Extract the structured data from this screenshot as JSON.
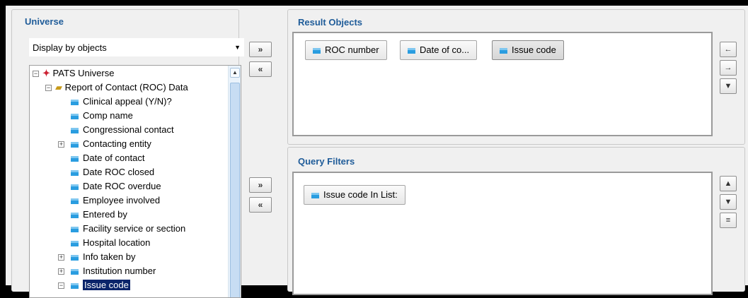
{
  "universe": {
    "title": "Universe",
    "display_select": "Display by objects",
    "tree": {
      "root": "PATS Universe",
      "folder": "Report of Contact (ROC) Data",
      "items": [
        {
          "label": "Clinical appeal (Y/N)?",
          "expandable": false,
          "selected": false
        },
        {
          "label": "Comp name",
          "expandable": false,
          "selected": false
        },
        {
          "label": "Congressional contact",
          "expandable": false,
          "selected": false
        },
        {
          "label": "Contacting entity",
          "expandable": true,
          "selected": false
        },
        {
          "label": "Date of contact",
          "expandable": false,
          "selected": false
        },
        {
          "label": "Date ROC closed",
          "expandable": false,
          "selected": false
        },
        {
          "label": "Date ROC overdue",
          "expandable": false,
          "selected": false
        },
        {
          "label": "Employee involved",
          "expandable": false,
          "selected": false
        },
        {
          "label": "Entered by",
          "expandable": false,
          "selected": false
        },
        {
          "label": "Facility service or section",
          "expandable": false,
          "selected": false
        },
        {
          "label": "Hospital location",
          "expandable": false,
          "selected": false
        },
        {
          "label": "Info taken by",
          "expandable": true,
          "selected": false
        },
        {
          "label": "Institution number",
          "expandable": true,
          "selected": false
        },
        {
          "label": "Issue code",
          "expandable": true,
          "expanded": true,
          "selected": true
        }
      ]
    }
  },
  "transfer": {
    "add_label": "»",
    "remove_label": "«"
  },
  "result_objects": {
    "title": "Result Objects",
    "chips": [
      {
        "label": "ROC number",
        "selected": false
      },
      {
        "label": "Date of co...",
        "selected": false
      },
      {
        "label": "Issue code",
        "selected": true
      }
    ],
    "side_buttons": [
      "left-arrow-icon",
      "right-arrow-icon",
      "filter-icon"
    ]
  },
  "query_filters": {
    "title": "Query Filters",
    "chips": [
      {
        "label": "Issue code In List:"
      }
    ],
    "side_buttons": [
      "up-arrow-icon",
      "down-arrow-icon",
      "indent-icon"
    ]
  }
}
